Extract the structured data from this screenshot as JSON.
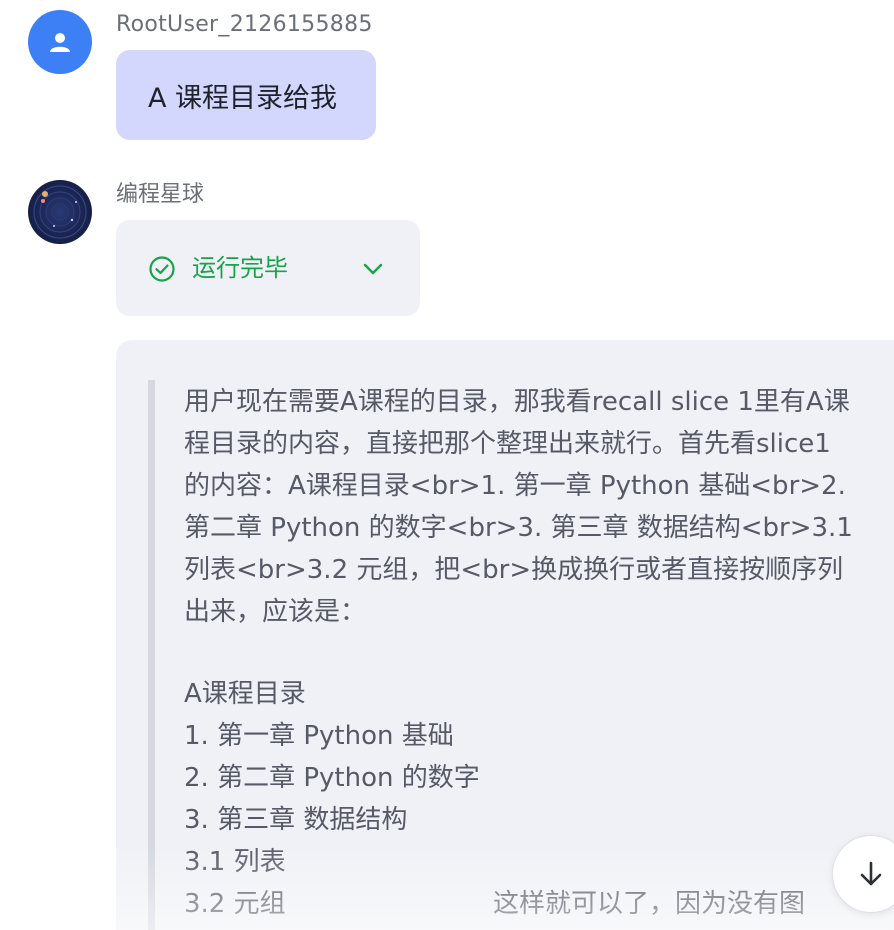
{
  "user": {
    "name": "RootUser_2126155885",
    "message": "A 课程目录给我"
  },
  "bot": {
    "name": "编程星球",
    "status": {
      "label": "运行完毕",
      "icon": "check-circle-icon",
      "color": "#16a34a"
    },
    "reasoning": "用户现在需要A课程的目录，那我看recall slice 1里有A课程目录的内容，直接把那个整理出来就行。首先看slice1的内容：A课程目录<br>1. 第一章 Python 基础<br>2. 第二章 Python 的数字<br>3. 第三章 数据结构<br>3.1 列表<br>3.2 元组，把<br>换成换行或者直接按顺序列出来，应该是：",
    "toc": [
      "A课程目录",
      "1. 第一章 Python 基础",
      "2. 第二章 Python 的数字",
      "3. 第三章 数据结构",
      "3.1 列表",
      "3.2 元组"
    ],
    "tail": "这样就可以了，因为没有图"
  },
  "controls": {
    "scroll_down_icon": "arrow-down-icon",
    "expand_icon": "chevron-down-icon"
  },
  "colors": {
    "user_avatar": "#3d7ff5",
    "user_bubble": "#d3d6fd",
    "card_bg": "#f0f1f6",
    "status_green": "#16a34a",
    "text_muted": "#565a66"
  }
}
